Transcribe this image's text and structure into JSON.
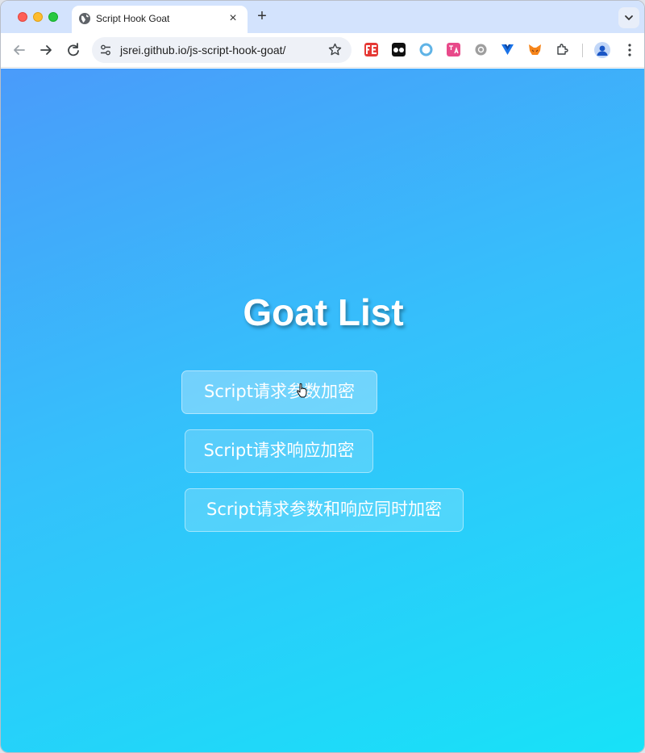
{
  "browser": {
    "tab_title": "Script Hook Goat",
    "tab_close": "×",
    "new_tab": "+",
    "url": "jsrei.github.io/js-script-hook-goat/"
  },
  "page": {
    "title": "Goat List",
    "buttons": [
      "Script请求参数加密",
      "Script请求响应加密",
      "Script请求参数和响应同时加密"
    ]
  }
}
